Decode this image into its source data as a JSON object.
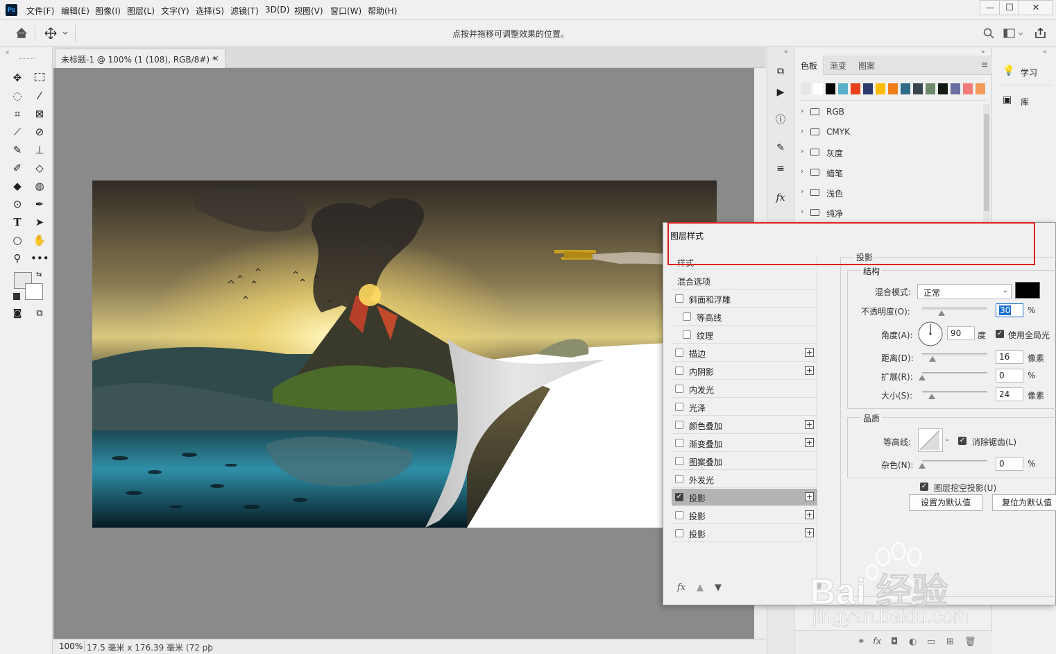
{
  "app": {
    "logo": "Ps",
    "menu": [
      "文件(F)",
      "编辑(E)",
      "图像(I)",
      "图层(L)",
      "文字(Y)",
      "选择(S)",
      "滤镜(T)",
      "3D(D)",
      "视图(V)",
      "窗口(W)",
      "帮助(H)"
    ],
    "window_controls": [
      "—",
      "☐",
      "✕"
    ]
  },
  "options_bar": {
    "hint": "点按并拖移可调整效果的位置。"
  },
  "document": {
    "tab_title": "未标题-1 @ 100% (1 (108), RGB/8#) *",
    "tab_close": "×",
    "status_zoom": "100%",
    "status_info": "17.5 毫米 x 176.39 毫米 (72 pp",
    "status_arrow": "›"
  },
  "swatch_panel": {
    "tabs": [
      "色板",
      "渐变",
      "图案"
    ],
    "swatch_colors": [
      "#e6e6e6",
      "#ffffff",
      "#000000",
      "#5aaec8",
      "#e8401c",
      "#2b3b6e",
      "#ffbd00",
      "#f07d1a",
      "#2f6a86",
      "#38474f",
      "#6d8a6a",
      "#121a14",
      "#6b6ea0",
      "#f47c78",
      "#f59b5a"
    ],
    "folders": [
      "RGB",
      "CMYK",
      "灰度",
      "蜡笔",
      "浅色",
      "纯净"
    ]
  },
  "learn_panel": {
    "items": [
      {
        "icon": "lightbulb-icon",
        "label": "学习"
      },
      {
        "icon": "library-icon",
        "label": "库"
      }
    ]
  },
  "layer_style_dialog": {
    "title": "图层样式",
    "styles_header": "样式",
    "blend_options": "混合选项",
    "styles": [
      {
        "label": "斜面和浮雕",
        "checked": false,
        "plus": false,
        "indent": false
      },
      {
        "label": "等高线",
        "checked": false,
        "plus": false,
        "indent": true
      },
      {
        "label": "纹理",
        "checked": false,
        "plus": false,
        "indent": true
      },
      {
        "label": "描边",
        "checked": false,
        "plus": true,
        "indent": false
      },
      {
        "label": "内阴影",
        "checked": false,
        "plus": true,
        "indent": false
      },
      {
        "label": "内发光",
        "checked": false,
        "plus": false,
        "indent": false
      },
      {
        "label": "光泽",
        "checked": false,
        "plus": false,
        "indent": false
      },
      {
        "label": "颜色叠加",
        "checked": false,
        "plus": true,
        "indent": false
      },
      {
        "label": "渐变叠加",
        "checked": false,
        "plus": true,
        "indent": false
      },
      {
        "label": "图案叠加",
        "checked": false,
        "plus": false,
        "indent": false
      },
      {
        "label": "外发光",
        "checked": false,
        "plus": false,
        "indent": false
      },
      {
        "label": "投影",
        "checked": true,
        "plus": true,
        "indent": false
      },
      {
        "label": "投影",
        "checked": false,
        "plus": true,
        "indent": false
      },
      {
        "label": "投影",
        "checked": false,
        "plus": true,
        "indent": false
      }
    ],
    "footer_icons": [
      "fx",
      "▲",
      "▼",
      "🗑"
    ],
    "section_title": "投影",
    "structure": {
      "title": "结构",
      "blend_mode_label": "混合模式:",
      "blend_mode_value": "正常",
      "shadow_color": "#000000",
      "opacity_label": "不透明度(O):",
      "opacity_value": "30",
      "opacity_unit": "%",
      "angle_label": "角度(A):",
      "angle_value": "90",
      "angle_unit": "度",
      "global_light_label": "使用全局光",
      "distance_label": "距离(D):",
      "distance_value": "16",
      "distance_unit": "像素",
      "spread_label": "扩展(R):",
      "spread_value": "0",
      "spread_unit": "%",
      "size_label": "大小(S):",
      "size_value": "24",
      "size_unit": "像素"
    },
    "quality": {
      "title": "品质",
      "contour_label": "等高线:",
      "anti_alias_label": "消除锯齿(L)",
      "noise_label": "杂色(N):",
      "noise_value": "0",
      "noise_unit": "%"
    },
    "knockout_label": "图层挖空投影(U)",
    "btn_set_default": "设置为默认值",
    "btn_reset_default": "复位为默认值"
  },
  "watermark": {
    "brand_text": "Bai  经验",
    "url_text": "jingyan.baidu.com"
  }
}
